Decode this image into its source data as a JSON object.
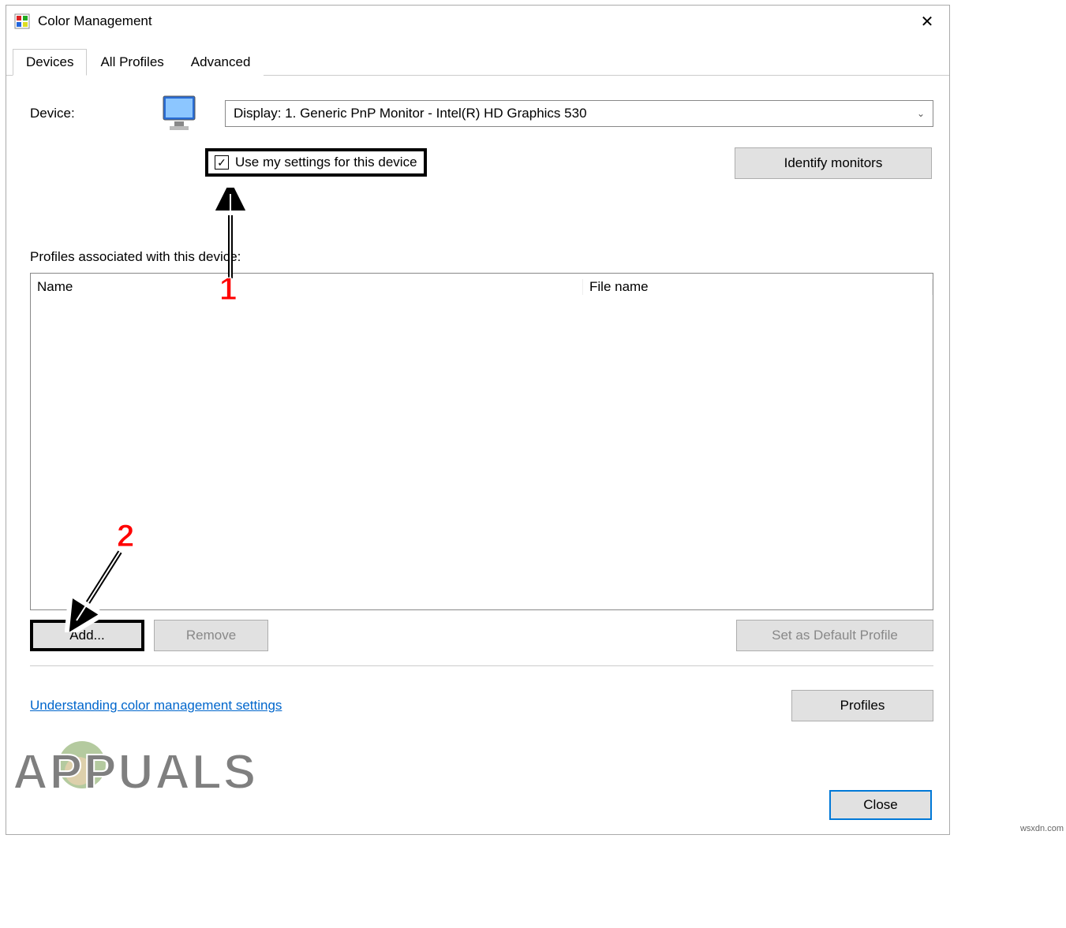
{
  "window": {
    "title": "Color Management",
    "close_icon": "✕"
  },
  "tabs": {
    "devices": "Devices",
    "all_profiles": "All Profiles",
    "advanced": "Advanced"
  },
  "device": {
    "label": "Device:",
    "selected": "Display: 1. Generic PnP Monitor - Intel(R) HD Graphics 530"
  },
  "checkbox": {
    "label": "Use my settings for this device",
    "checked_glyph": "✓"
  },
  "buttons": {
    "identify": "Identify monitors",
    "add": "Add...",
    "remove": "Remove",
    "set_default": "Set as Default Profile",
    "profiles": "Profiles",
    "close": "Close"
  },
  "profiles_section": {
    "label": "Profiles associated with this device:",
    "col_name": "Name",
    "col_filename": "File name"
  },
  "link": {
    "help": "Understanding color management settings"
  },
  "annotations": {
    "one": "1",
    "two": "2"
  },
  "watermark": {
    "text": "APPUALS",
    "site": "wsxdn.com"
  }
}
